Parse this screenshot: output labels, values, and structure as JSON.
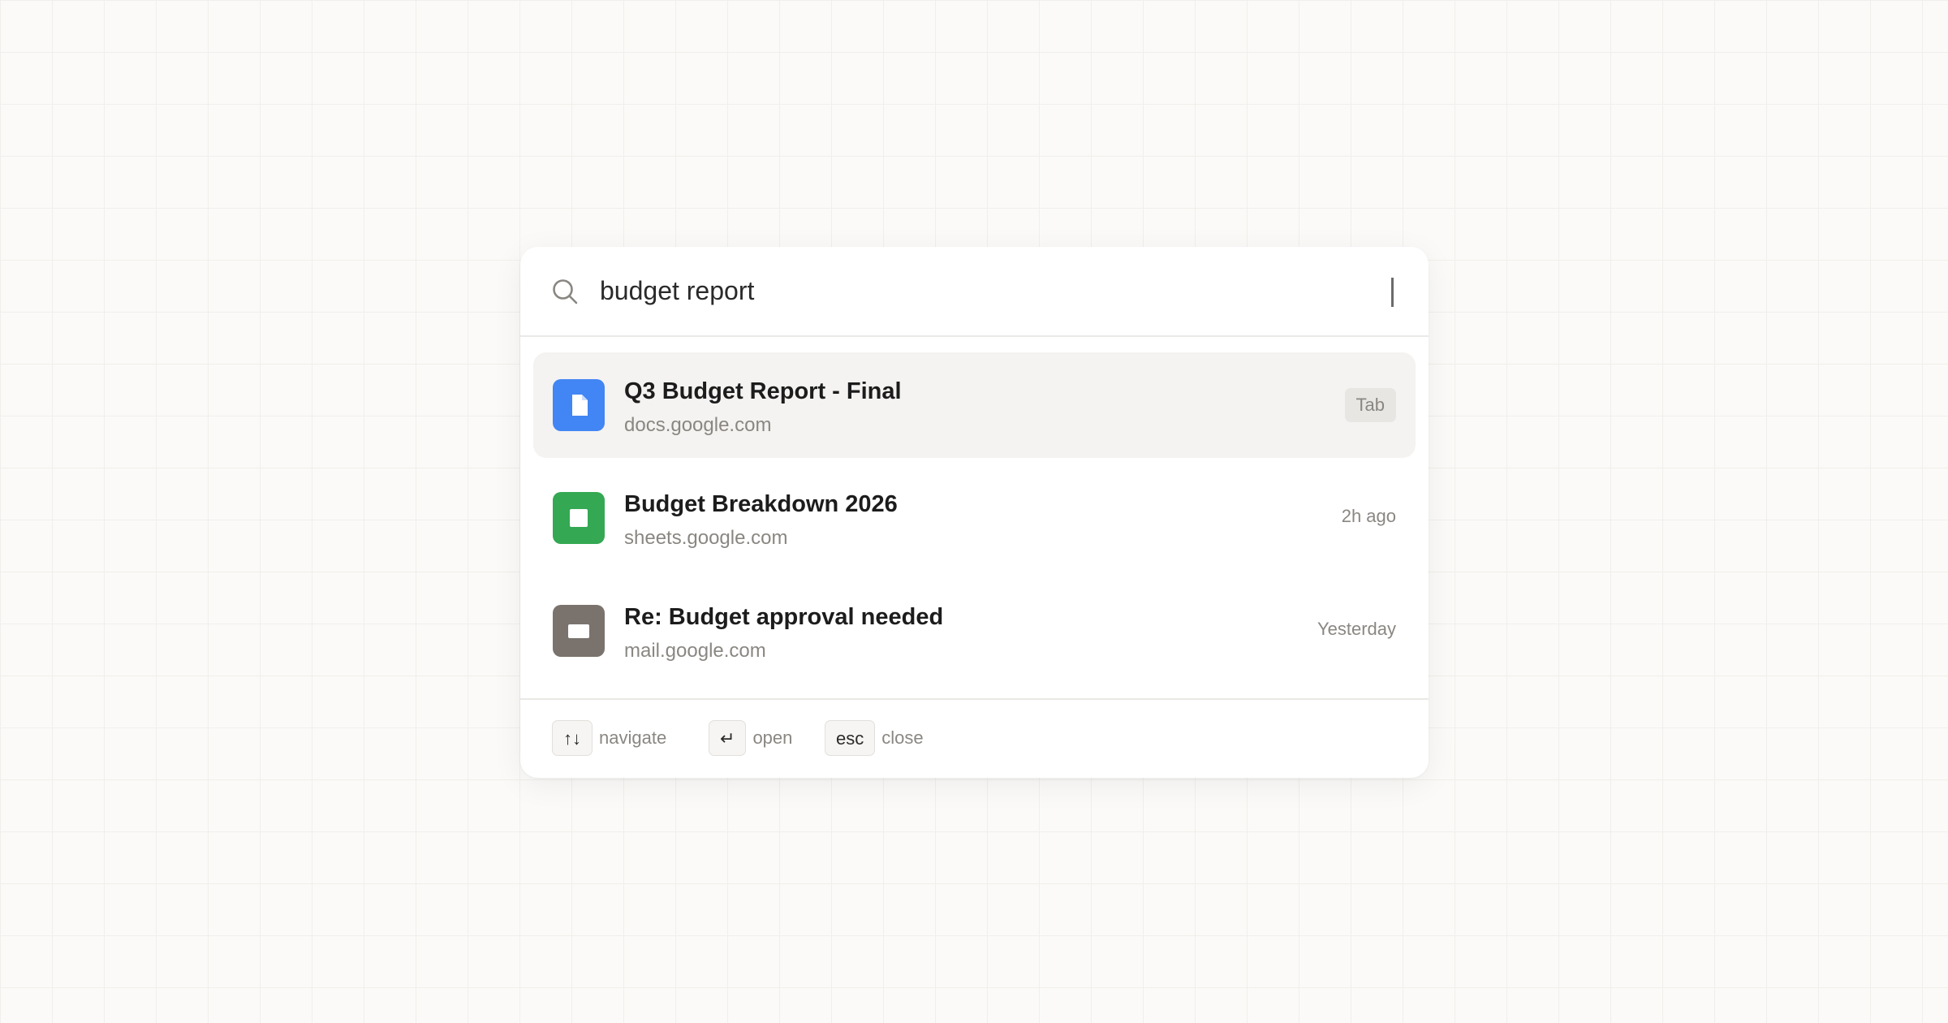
{
  "search": {
    "query": "budget report"
  },
  "results": [
    {
      "title": "Q3 Budget Report - Final",
      "subtitle": "docs.google.com",
      "badge": "Tab",
      "icon": "document-icon",
      "icon_color": "#4285f4",
      "selected": true
    },
    {
      "title": "Budget Breakdown 2026",
      "subtitle": "sheets.google.com",
      "meta": "2h ago",
      "icon": "spreadsheet-icon",
      "icon_color": "#34a853",
      "selected": false
    },
    {
      "title": "Re: Budget approval needed",
      "subtitle": "mail.google.com",
      "meta": "Yesterday",
      "icon": "mail-icon",
      "icon_color": "#7a736d",
      "selected": false
    }
  ],
  "footer": {
    "navigate_key": "↑↓",
    "navigate_label": "navigate",
    "open_key": "↵",
    "open_label": "open",
    "close_key": "esc",
    "close_label": "close"
  }
}
